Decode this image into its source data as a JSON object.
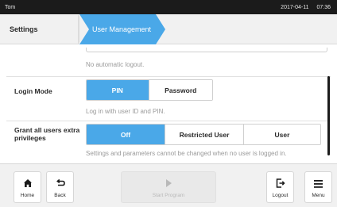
{
  "status_bar": {
    "user": "Tom",
    "date": "2017-04-11",
    "time": "07:36"
  },
  "breadcrumb": {
    "items": [
      "Settings",
      "User Management"
    ]
  },
  "logout_section": {
    "hint": "No automatic logout."
  },
  "login_mode": {
    "label": "Login Mode",
    "options": [
      "PIN",
      "Password"
    ],
    "selected": "PIN",
    "hint": "Log in with user ID and PIN."
  },
  "privileges": {
    "label": "Grant all users extra privileges",
    "options": [
      "Off",
      "Restricted User",
      "User"
    ],
    "selected": "Off",
    "hint": "Settings and parameters cannot be changed when no user is logged in."
  },
  "bottom_bar": {
    "home": "Home",
    "back": "Back",
    "start_program": "Start Program",
    "logout": "Logout",
    "menu": "Menu"
  },
  "colors": {
    "accent": "#4aa8e8",
    "status_bar": "#1b1b1b",
    "panel": "#f1f1f1"
  },
  "icons": {
    "home": "home-icon",
    "back": "back-arrow-icon",
    "start": "play-icon",
    "logout": "logout-icon",
    "menu": "hamburger-menu-icon"
  }
}
